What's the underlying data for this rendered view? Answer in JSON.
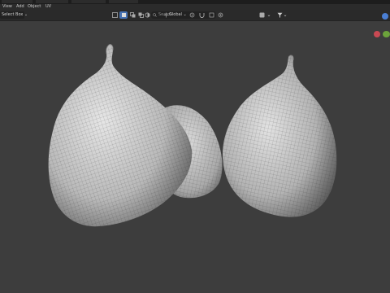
{
  "menubar": {
    "items": [
      {
        "id": "view",
        "label": "View"
      },
      {
        "id": "add",
        "label": "Add"
      },
      {
        "id": "object",
        "label": "Object"
      },
      {
        "id": "uv",
        "label": "UV"
      }
    ]
  },
  "toolbar": {
    "select_mode": "Select Box",
    "search_placeholder": "Search",
    "orientation": "Global"
  },
  "gizmo": {
    "x_color": "#c94953",
    "y_color": "#6ca33b",
    "z_color": "#4a7fd4"
  }
}
